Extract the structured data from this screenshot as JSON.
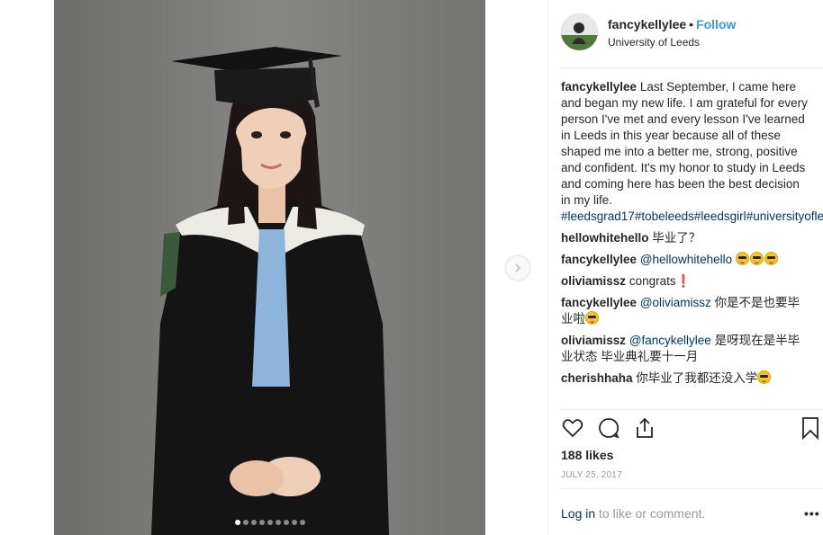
{
  "post": {
    "username": "fancykellylee",
    "separator": "•",
    "follow_label": "Follow",
    "location": "University of Leeds",
    "caption": {
      "username": "fancykellylee",
      "text": "Last September, I came here and began my new life. I am grateful for every person I've met and every lesson I've learned in Leeds in this year because all of these shaped me into a better me, strong, positive and confident. It's my honor to study in Leeds and coming here has been the best decision in my life.",
      "hashtags": [
        "#leedsgrad17",
        "#tobeleeds",
        "#leedsgirl",
        "#universityofleeds"
      ]
    },
    "comments": [
      {
        "user": "hellowhitehello",
        "text": "毕业了？",
        "mention": "",
        "emoji_count": 0
      },
      {
        "user": "fancykellylee",
        "mention": "@hellowhitehello",
        "text": "",
        "emoji": "sunglasses-emoji",
        "emoji_count": 3
      },
      {
        "user": "oliviamissz",
        "text": "congrats❗️",
        "mention": "",
        "emoji_count": 0
      },
      {
        "user": "fancykellylee",
        "mention": "@oliviamissz",
        "text": "你是不是也要毕业啦",
        "emoji": "sunglasses-emoji",
        "emoji_count": 1
      },
      {
        "user": "oliviamissz",
        "mention": "@fancykellylee",
        "text": "是呀现在是半毕业状态 毕业典礼要十一月",
        "emoji_count": 0
      },
      {
        "user": "cherishhaha",
        "mention": "",
        "text": "你毕业了我都还没入学",
        "emoji": "expressionless-emoji",
        "emoji_count": 1
      }
    ],
    "likes": "188 likes",
    "date": "JULY 25, 2017",
    "login_link": "Log in",
    "login_suffix": "to like or comment.",
    "more_label": "•••",
    "carousel_count": 9,
    "carousel_active_index": 0
  },
  "colors": {
    "accent": "#3897f0",
    "link": "#003569",
    "muted": "#999999"
  },
  "icons": [
    "heart-icon",
    "comment-icon",
    "share-icon",
    "bookmark-icon",
    "chevron-right-icon"
  ]
}
